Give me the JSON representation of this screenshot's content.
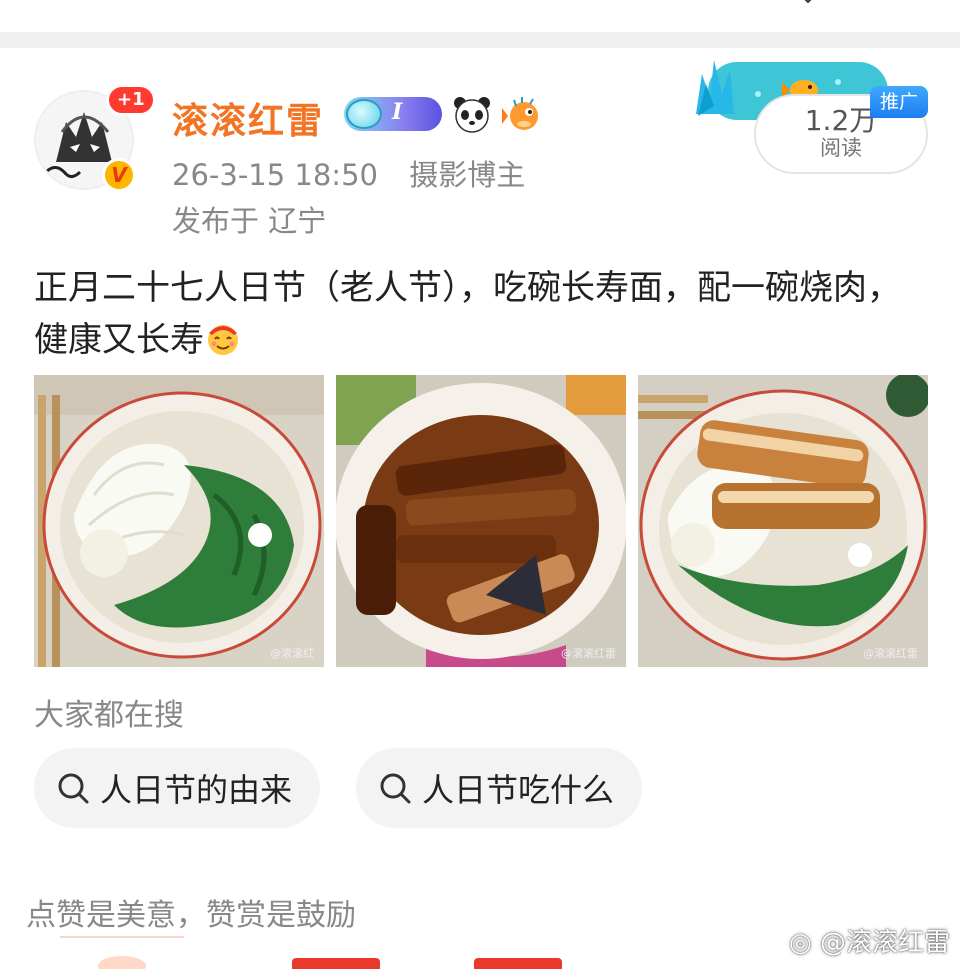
{
  "user": {
    "name": "滚滚红雷",
    "follow_badge": "+1",
    "verified_mark": "V",
    "level_letter": "I",
    "time": "26-3-15 18:50",
    "role": "摄影博主",
    "location": "发布于 辽宁"
  },
  "stats": {
    "read_count": "1.2万",
    "read_label": "阅读",
    "promo_tag": "推广"
  },
  "post": {
    "text": "正月二十七人日节（老人节），吃碗长寿面，配一碗烧肉，健康又长寿",
    "images": [
      {
        "subject": "noodles-with-spinach",
        "watermark": "@滚滚红"
      },
      {
        "subject": "braised-pork-bowl",
        "watermark": "@滚滚红雷"
      },
      {
        "subject": "noodles-with-pork",
        "watermark": "@滚滚红雷"
      }
    ]
  },
  "search": {
    "title": "大家都在搜",
    "chips": [
      "人日节的由来",
      "人日节吃什么"
    ]
  },
  "footer": {
    "like_text": "点赞是美意，赞赏是鼓励",
    "credit": "@滚滚红雷"
  },
  "colors": {
    "username": "#f27525",
    "muted": "#888888",
    "promo": "#1c7ef0",
    "badge": "#ff3b30"
  },
  "icons": [
    "avatar-wolf",
    "verified-icon",
    "brain-level-icon",
    "panda-icon",
    "pufferfish-icon",
    "coral-fish-decoration",
    "search-icon",
    "weibo-logo-icon"
  ]
}
